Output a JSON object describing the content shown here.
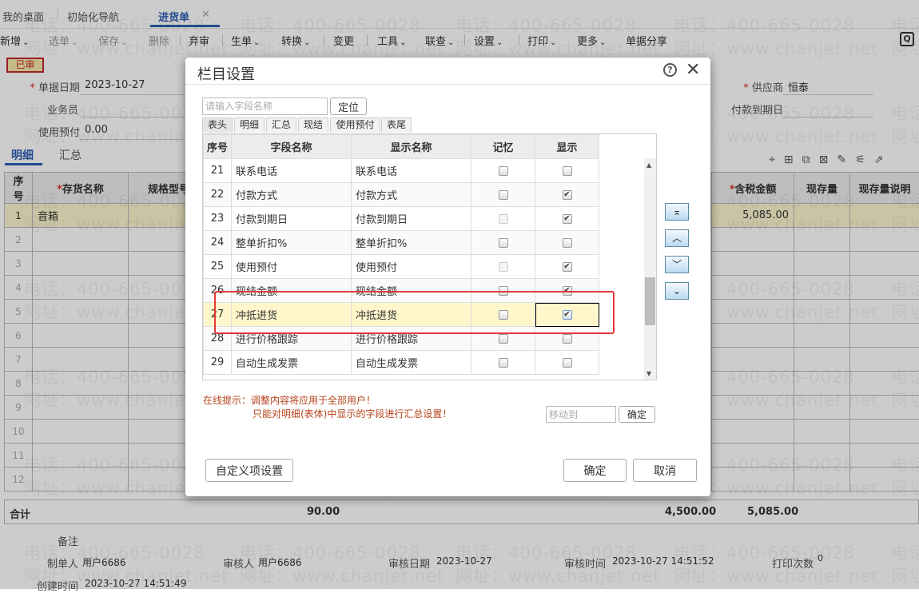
{
  "watermark": {
    "phone": "电话：400-665-0028",
    "site": "网址：www.chanjet.net"
  },
  "top_tabs": [
    {
      "label": "我的桌面"
    },
    {
      "label": "初始化导航"
    },
    {
      "label": "进货单",
      "close": "✕"
    }
  ],
  "toolbar": {
    "items": [
      "新增",
      "选单",
      "保存",
      "删除",
      "弃审",
      "生单",
      "转换",
      "变更",
      "工具",
      "联查",
      "设置",
      "打印",
      "更多",
      "单据分享"
    ],
    "chevron": "⌄"
  },
  "status_badge": "已审",
  "header_fields": {
    "date_label": "单据日期",
    "date_value": "2023-10-27",
    "salesman_label": "业务员",
    "prepay_label": "使用预付",
    "prepay_value": "0.00",
    "supplier_label": "供应商",
    "supplier_value": "恒泰",
    "due_label": "付款到期日"
  },
  "detail_tabs": [
    "明细",
    "汇总"
  ],
  "detail_table": {
    "headers": [
      "序号",
      "存货名称",
      "规格型号",
      "含税金额",
      "现存量",
      "现存量说明"
    ],
    "rows": [
      {
        "no": "1",
        "name": "音箱",
        "amount": "5,085.00"
      },
      {
        "no": "2"
      },
      {
        "no": "3"
      },
      {
        "no": "4"
      },
      {
        "no": "5"
      },
      {
        "no": "6"
      },
      {
        "no": "7"
      },
      {
        "no": "8"
      },
      {
        "no": "9"
      },
      {
        "no": "10"
      },
      {
        "no": "11"
      },
      {
        "no": "12"
      }
    ],
    "totals": {
      "label": "合计",
      "qty": "90.00",
      "amount": "4,500.00",
      "tax_amount": "5,085.00"
    }
  },
  "footer": {
    "remark_label": "备注",
    "maker_label": "制单人",
    "maker_value": "用户6686",
    "auditor_label": "审核人",
    "auditor_value": "用户6686",
    "audit_date_label": "审核日期",
    "audit_date_value": "2023-10-27",
    "audit_time_label": "审核时间",
    "audit_time_value": "2023-10-27 14:51:52",
    "print_count_label": "打印次数",
    "print_count_value": "0",
    "created_label": "创建时间",
    "created_value": "2023-10-27 14:51:49"
  },
  "dialog": {
    "title": "栏目设置",
    "search_placeholder": "请输入字段名称",
    "locate_label": "定位",
    "tabs": [
      "表头",
      "明细",
      "汇总",
      "现结",
      "使用预付",
      "表尾"
    ],
    "active_tab": 0,
    "columns": [
      "序号",
      "字段名称",
      "显示名称",
      "记忆",
      "显示"
    ],
    "rows": [
      {
        "no": "21",
        "field": "联系电话",
        "display": "联系电话",
        "memory": false,
        "memory_disabled": false,
        "show": false
      },
      {
        "no": "22",
        "field": "付款方式",
        "display": "付款方式",
        "memory": false,
        "memory_disabled": false,
        "show": true
      },
      {
        "no": "23",
        "field": "付款到期日",
        "display": "付款到期日",
        "memory": false,
        "memory_disabled": true,
        "show": true
      },
      {
        "no": "24",
        "field": "整单折扣%",
        "display": "整单折扣%",
        "memory": false,
        "memory_disabled": false,
        "show": false
      },
      {
        "no": "25",
        "field": "使用预付",
        "display": "使用预付",
        "memory": false,
        "memory_disabled": true,
        "show": true
      },
      {
        "no": "26",
        "field": "现结金额",
        "display": "现结金额",
        "memory": false,
        "memory_disabled": false,
        "show": true
      },
      {
        "no": "27",
        "field": "冲抵进货",
        "display": "冲抵进货",
        "memory": false,
        "memory_disabled": false,
        "show": true,
        "highlighted": true
      },
      {
        "no": "28",
        "field": "进行价格跟踪",
        "display": "进行价格跟踪",
        "memory": false,
        "memory_disabled": false,
        "show": false
      },
      {
        "no": "29",
        "field": "自动生成发票",
        "display": "自动生成发票",
        "memory": false,
        "memory_disabled": false,
        "show": false
      }
    ],
    "move_buttons": [
      "⌅",
      "︿",
      "﹀",
      "⌄"
    ],
    "hint_line1": "在线提示：调整内容将应用于全部用户！",
    "hint_line2": "只能对明细(表体)中显示的字段进行汇总设置！",
    "move_to_placeholder": "移动到",
    "move_confirm": "确定",
    "custom_button": "自定义项设置",
    "ok_button": "确定",
    "cancel_button": "取消"
  }
}
